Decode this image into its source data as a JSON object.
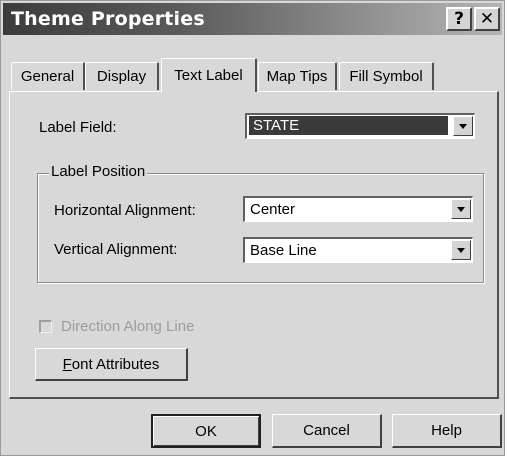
{
  "window": {
    "title": "Theme Properties",
    "help_glyph": "?",
    "close_glyph": "✕"
  },
  "tabs": [
    {
      "label": "General",
      "active": false
    },
    {
      "label": "Display",
      "active": false
    },
    {
      "label": "Text Label",
      "active": true
    },
    {
      "label": "Map Tips",
      "active": false
    },
    {
      "label": "Fill Symbol",
      "active": false
    }
  ],
  "text_label_tab": {
    "label_field": {
      "label": "Label Field:",
      "value": "STATE"
    },
    "label_position": {
      "title": "Label Position",
      "horizontal_alignment": {
        "label": "Horizontal Alignment:",
        "value": "Center"
      },
      "vertical_alignment": {
        "label": "Vertical Alignment:",
        "value": "Base Line"
      }
    },
    "direction_along_line": {
      "label": "Direction Along Line",
      "checked": false,
      "enabled": false
    },
    "font_attributes_button": "Font Attributes"
  },
  "footer": {
    "ok": "OK",
    "cancel": "Cancel",
    "help": "Help"
  },
  "colors": {
    "dialog_face": "#d8d8d8",
    "selection": "#3a3a3a",
    "disabled_text": "#9c9c9c"
  }
}
